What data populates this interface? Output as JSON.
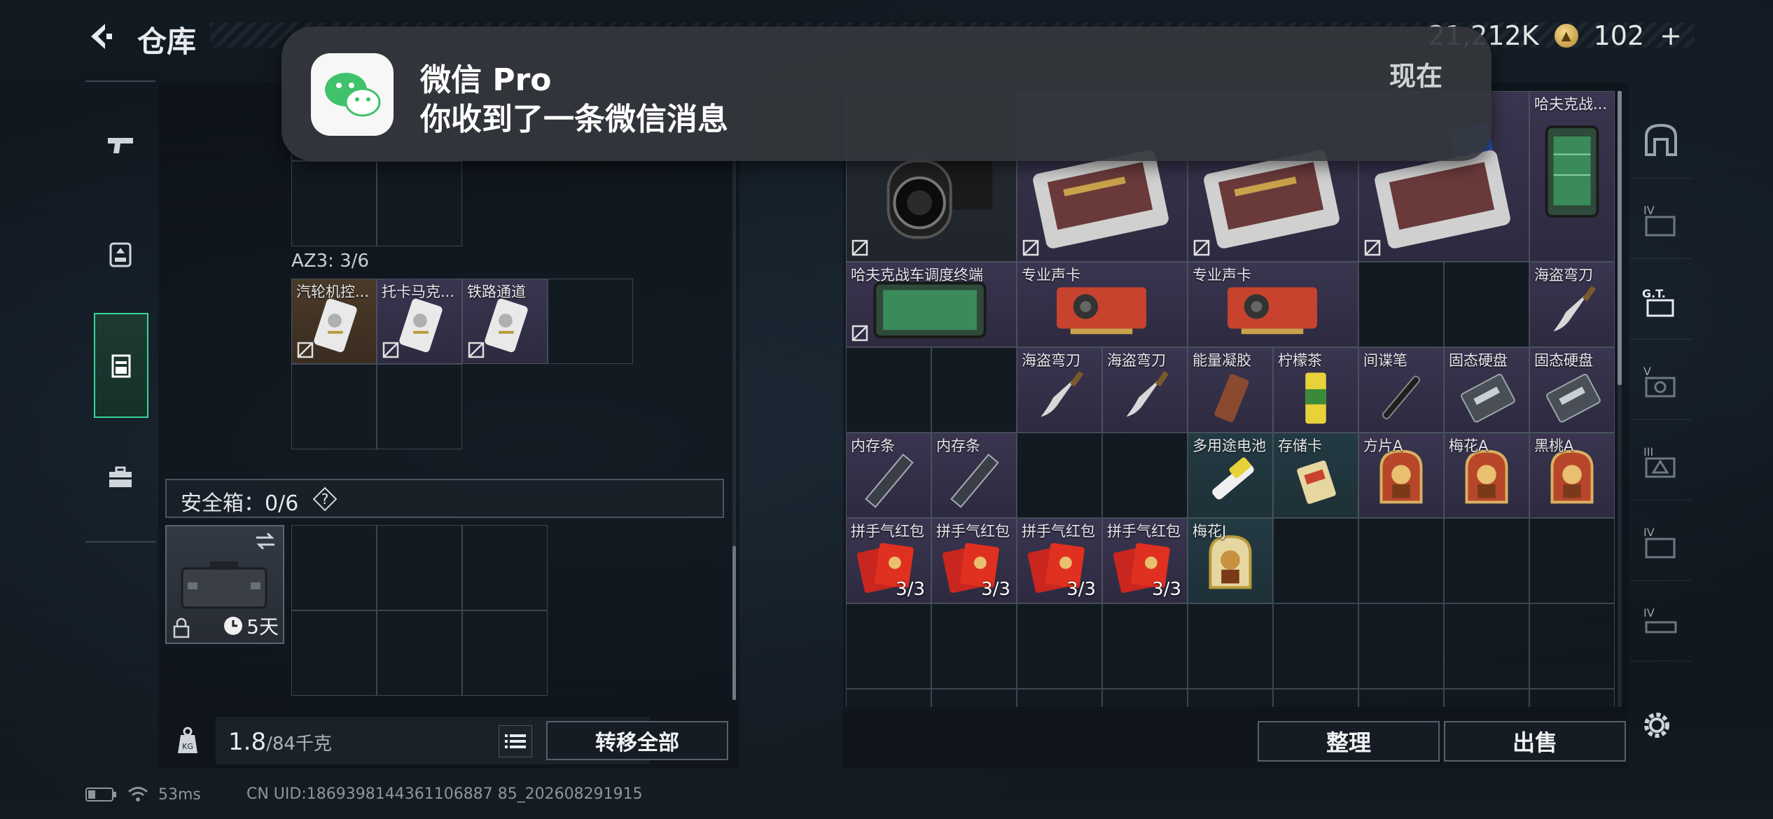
{
  "header": {
    "title": "仓库",
    "currency_1": "21,212K",
    "currency_2": "102",
    "add_symbol": "+"
  },
  "notification": {
    "app": "微信 Pro",
    "message": "你收到了一条微信消息",
    "time": "现在"
  },
  "left": {
    "container_label": "AZ3: 3/6",
    "az3_items": [
      {
        "name": "汽轮机控..."
      },
      {
        "name": "托卡马克..."
      },
      {
        "name": "铁路通道"
      }
    ],
    "safe_box_label": "安全箱：0/6",
    "help_symbol": "?",
    "safe_case_days": "5天",
    "weight_current": "1.8",
    "weight_max": "/84千克",
    "transfer_all": "转移全部"
  },
  "right": {
    "items": {
      "hafuke_top": "哈夫克战...",
      "terminal": "哈夫克战车调度终端",
      "sound_card_1": "专业声卡",
      "sound_card_2": "专业声卡",
      "pirate_knife_top": "海盗弯刀",
      "pirate_knife_2": "海盗弯刀",
      "pirate_knife_3": "海盗弯刀",
      "energy_gel": "能量凝胶",
      "lemon_tea": "柠檬茶",
      "spy_pen": "间谍笔",
      "ssd_1": "固态硬盘",
      "ssd_2": "固态硬盘",
      "ram_1": "内存条",
      "ram_2": "内存条",
      "battery": "多用途电池",
      "memory_card": "存储卡",
      "diamond_a": "方片A",
      "club_a": "梅花A",
      "spade_a": "黑桃A",
      "red_packet_1": "拼手气红包",
      "red_packet_2": "拼手气红包",
      "red_packet_3": "拼手气红包",
      "red_packet_4": "拼手气红包",
      "club_j": "梅花J",
      "red_packet_count": "3/3"
    },
    "sort_label": "整理",
    "sell_label": "出售"
  },
  "status": {
    "ping": "53ms",
    "uid": "CN UID:1869398144361106887 85_202608291915"
  },
  "colors": {
    "accent_green": "#3bd39a",
    "panel_bg": "#0e1319"
  }
}
